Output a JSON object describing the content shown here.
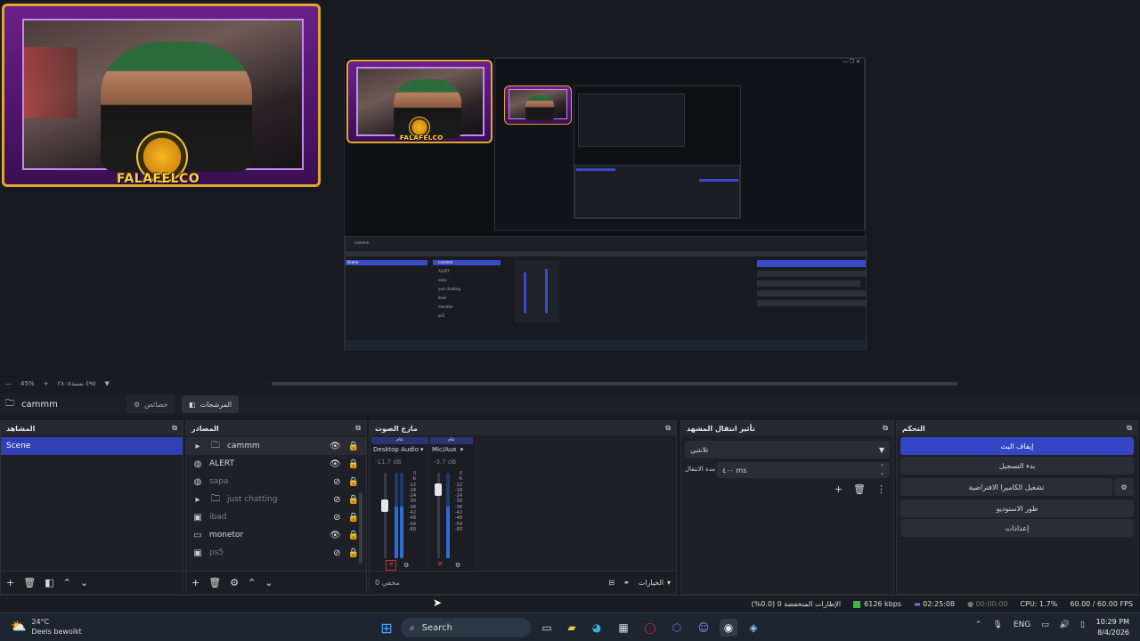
{
  "preview": {
    "zoom": "45%",
    "canvas_label": "٢٨٠x٤٩٥ نسبة",
    "logo_text": "FALAFELCO"
  },
  "scene_bar": {
    "scene_name": "cammm",
    "tab_properties": "خصائص",
    "tab_filters": "المرشحات"
  },
  "scenes": {
    "title": "المشاهد",
    "items": [
      "Scene"
    ]
  },
  "sources": {
    "title": "المصادر",
    "items": [
      {
        "name": "cammm",
        "group": true,
        "visible": true
      },
      {
        "name": "ALERT",
        "group": false,
        "visible": true
      },
      {
        "name": "sapa",
        "group": false,
        "visible": false
      },
      {
        "name": "just chatting",
        "group": true,
        "visible": false
      },
      {
        "name": "ibad",
        "group": false,
        "visible": false
      },
      {
        "name": "monetor",
        "group": false,
        "visible": true
      },
      {
        "name": "ps5",
        "group": false,
        "visible": false
      }
    ]
  },
  "mixer": {
    "title": "مازج الصوت",
    "channels": [
      {
        "badge": "عام",
        "name": "Desktop Audio",
        "db": "-11.7 dB"
      },
      {
        "badge": "عام",
        "name": "Mic/Aux",
        "db": "-3.7 dB"
      }
    ],
    "ticks": [
      "0",
      "-6",
      "-12",
      "-18",
      "-24",
      "-30",
      "-36",
      "-42",
      "-48",
      "-54",
      "-60"
    ],
    "footer_left": "مخفي 0",
    "footer_options": "الخيارات"
  },
  "transitions": {
    "title": "تأثير انتقال المشهد",
    "type": "تلاشي",
    "duration_label": "مدة الانتقال",
    "duration_value": "٤٠٠ ms"
  },
  "controls": {
    "title": "التحكم",
    "stop_stream": "إيقاف البث",
    "start_record": "بدء التسجيل",
    "virtual_camera": "تشغيل الكاميرا الافتراضية",
    "studio_mode": "طور الاستوديو",
    "settings": "إعدادات"
  },
  "status": {
    "dropped": "الإطارات المنخفضة 0 (0.0%)",
    "kbps": "6126 kbps",
    "stream_time": "02:25:08",
    "record_time": "00:00:00",
    "cpu": "CPU: 1.7%",
    "fps": "60.00 / 60.00 FPS"
  },
  "taskbar": {
    "temp": "24°C",
    "weather": "Deels bewolkt",
    "search": "Search",
    "lang": "ENG",
    "time": "10:29 PM",
    "date": "8/4/2026"
  },
  "colors": {
    "accent": "#3346c4",
    "selection": "#2f3fb4",
    "frame_gold": "#e0a82a",
    "frame_purple": "#6b1f8a"
  }
}
